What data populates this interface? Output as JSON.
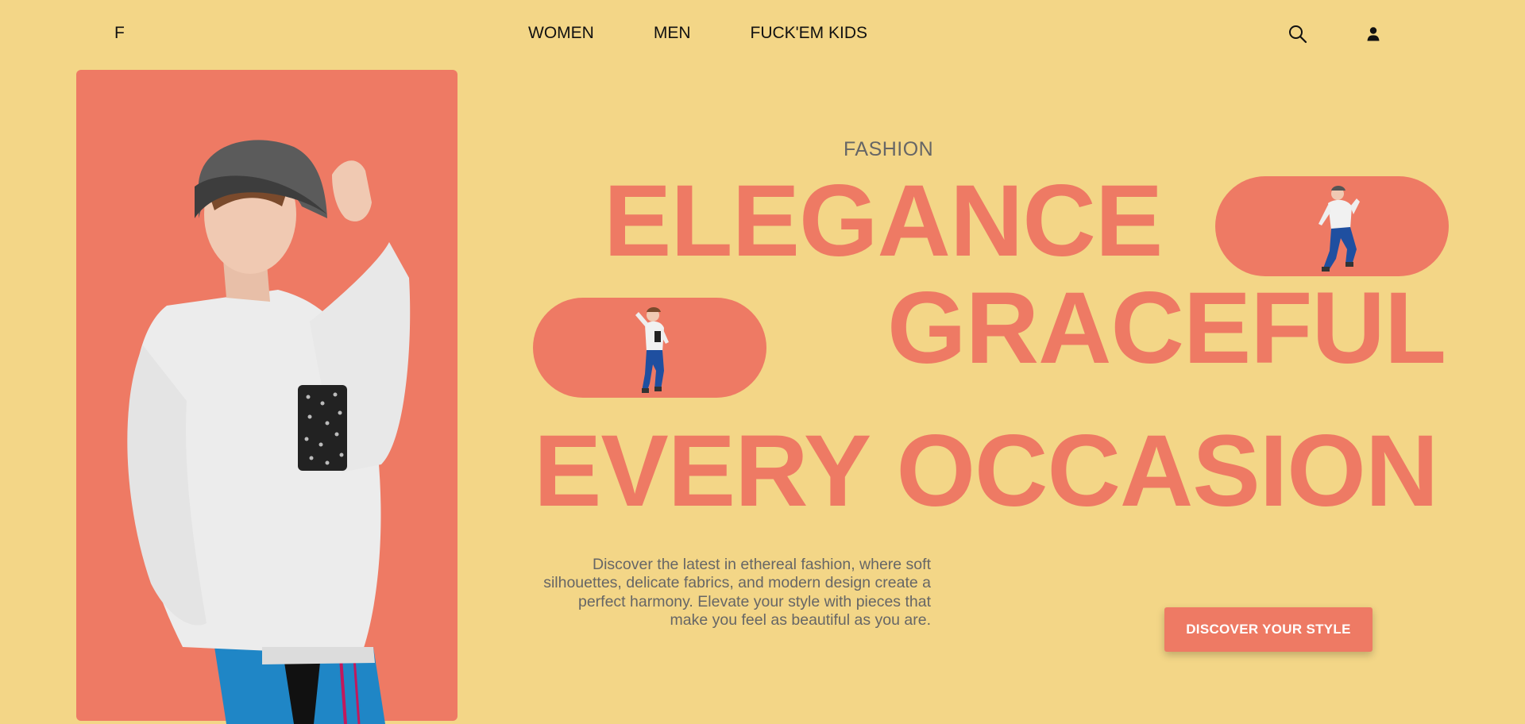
{
  "header": {
    "logo": "F",
    "nav": [
      {
        "label": "WOMEN"
      },
      {
        "label": "MEN"
      },
      {
        "label": "FUCK'EM KIDS"
      }
    ],
    "icons": {
      "search": "search-icon",
      "account": "user-icon"
    }
  },
  "hero": {
    "eyebrow": "FASHION",
    "headline": {
      "line1": "ELEGANCE",
      "line2": "GRACEFUL",
      "line3": "EVERY OCCASION"
    },
    "description": "Discover the latest in ethereal fashion, where soft silhouettes, delicate fabrics, and modern design create a perfect harmony. Elevate your style with pieces that make you feel as beautiful as you are.",
    "cta_label": "DISCOVER YOUR STYLE"
  },
  "colors": {
    "background": "#f3d687",
    "accent": "#ee7a64",
    "muted_text": "#666666",
    "text": "#111111"
  }
}
